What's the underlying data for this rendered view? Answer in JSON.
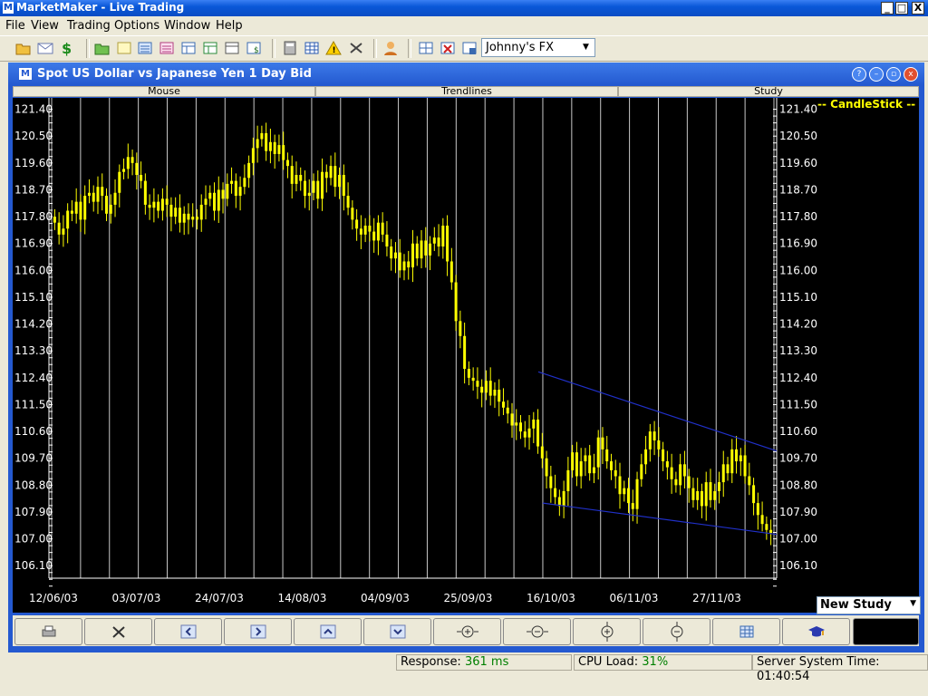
{
  "app": {
    "title": "MarketMaker - Live Trading",
    "icon_letter": "M"
  },
  "window_buttons": {
    "minimize": "_",
    "maximize": "□",
    "close": "X"
  },
  "menu": [
    "File",
    "View",
    "Trading",
    "Options",
    "Window",
    "Help"
  ],
  "toolbar": {
    "account_combo": "Johnny's FX"
  },
  "chart_window": {
    "title": "Spot US Dollar vs Japanese Yen 1 Day Bid",
    "icon_letter": "M"
  },
  "tabs": [
    "Mouse",
    "Trendlines",
    "Study"
  ],
  "study_panel": {
    "label": "-- CandleStick --",
    "label_color": "#ffff00",
    "dropdown": "New Study"
  },
  "status": {
    "response_label": "Response:",
    "response_value": "361 ms",
    "cpu_label": "CPU Load:",
    "cpu_value": "31%",
    "time_label": "Server System Time:",
    "time_value": "01:40:54"
  },
  "colors": {
    "candle": "#ffff00",
    "trendline": "#2030c8",
    "gridline": "#c8c8c8",
    "axis_text": "#ffffff"
  },
  "chart_data": {
    "type": "candlestick",
    "title": "Spot US Dollar vs Japanese Yen 1 Day Bid",
    "ylim": [
      105.5,
      121.6
    ],
    "y_ticks": [
      "121.40",
      "120.50",
      "119.60",
      "118.70",
      "117.80",
      "116.90",
      "116.00",
      "115.10",
      "114.20",
      "113.30",
      "112.40",
      "111.50",
      "110.60",
      "109.70",
      "108.80",
      "107.90",
      "107.00",
      "106.10"
    ],
    "x_ticks": [
      "12/06/03",
      "03/07/03",
      "24/07/03",
      "14/08/03",
      "04/09/03",
      "25/09/03",
      "16/10/03",
      "06/11/03",
      "27/11/03"
    ],
    "close": [
      117.6,
      117.2,
      117.4,
      118.0,
      117.9,
      118.3,
      117.7,
      118.5,
      118.6,
      118.3,
      118.8,
      118.5,
      117.9,
      118.2,
      118.6,
      119.3,
      119.4,
      119.8,
      119.6,
      119.2,
      119.0,
      118.2,
      118.1,
      118.3,
      118.0,
      118.4,
      118.2,
      117.8,
      118.1,
      117.6,
      117.9,
      117.7,
      117.8,
      117.7,
      118.2,
      118.4,
      118.6,
      118.0,
      118.7,
      118.4,
      118.9,
      119.0,
      118.5,
      118.8,
      119.1,
      119.6,
      120.1,
      120.4,
      120.6,
      120.0,
      120.3,
      119.9,
      120.2,
      119.7,
      119.5,
      118.9,
      119.2,
      119.0,
      118.5,
      118.6,
      119.0,
      118.4,
      119.3,
      119.1,
      119.5,
      118.8,
      119.2,
      118.5,
      118.1,
      117.7,
      117.4,
      117.2,
      117.5,
      117.3,
      117.0,
      117.6,
      117.2,
      116.8,
      116.4,
      116.6,
      116.0,
      116.3,
      116.1,
      116.9,
      116.4,
      117.0,
      116.5,
      116.9,
      117.1,
      116.8,
      117.5,
      116.3,
      115.6,
      114.3,
      113.8,
      112.7,
      112.4,
      112.3,
      112.1,
      111.9,
      112.3,
      111.8,
      112.0,
      111.6,
      111.4,
      111.2,
      110.8,
      110.9,
      110.6,
      110.4,
      110.7,
      111.0,
      110.1,
      109.7,
      109.1,
      108.7,
      108.4,
      108.1,
      108.6,
      109.3,
      109.9,
      109.1,
      109.6,
      109.8,
      109.2,
      109.4,
      110.4,
      110.0,
      109.6,
      109.3,
      109.1,
      108.5,
      108.7,
      108.2,
      108.0,
      109.0,
      109.5,
      110.0,
      110.6,
      110.3,
      110.0,
      109.6,
      109.4,
      109.0,
      108.8,
      109.5,
      109.1,
      108.7,
      108.3,
      108.6,
      108.1,
      108.9,
      108.3,
      108.6,
      108.9,
      109.5,
      109.2,
      110.0,
      109.6,
      109.8,
      109.1,
      108.8,
      108.2,
      107.8,
      107.5,
      107.3,
      107.2
    ]
  }
}
